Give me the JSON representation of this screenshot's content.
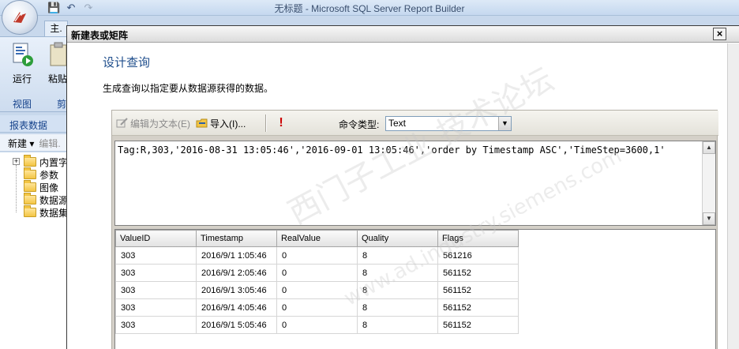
{
  "app": {
    "title": "无标题 - Microsoft SQL Server Report Builder",
    "ribbon_tab": "主.",
    "run_label": "运行",
    "paste_label": "粘贴",
    "group_view": "视图",
    "group_clipboard": "剪"
  },
  "report_data": {
    "header": "报表数据",
    "new_label": "新建 ▾",
    "edit_label": "编辑.",
    "tree": [
      {
        "label": "内置字"
      },
      {
        "label": "参数"
      },
      {
        "label": "图像"
      },
      {
        "label": "数据源"
      },
      {
        "label": "数据集"
      }
    ]
  },
  "dialog": {
    "title": "新建表或矩阵",
    "close": "×",
    "heading": "设计查询",
    "description": "生成查询以指定要从数据源获得的数据。",
    "toolbar": {
      "edit_as_text": "编辑为文本(E)",
      "import": "导入(I)...",
      "run": "!",
      "command_type_label": "命令类型:",
      "command_type_value": "Text"
    },
    "query_text": "Tag:R,303,'2016-08-31 13:05:46','2016-09-01 13:05:46','order by Timestamp ASC','TimeStep=3600,1'",
    "results": {
      "columns": [
        "ValueID",
        "Timestamp",
        "RealValue",
        "Quality",
        "Flags"
      ],
      "rows": [
        [
          "303",
          "2016/9/1 1:05:46",
          "0",
          "8",
          "561216"
        ],
        [
          "303",
          "2016/9/1 2:05:46",
          "0",
          "8",
          "561152"
        ],
        [
          "303",
          "2016/9/1 3:05:46",
          "0",
          "8",
          "561152"
        ],
        [
          "303",
          "2016/9/1 4:05:46",
          "0",
          "8",
          "561152"
        ],
        [
          "303",
          "2016/9/1 5:05:46",
          "0",
          "8",
          "561152"
        ]
      ]
    }
  },
  "watermark": {
    "line1": "西门子工业 技术论坛",
    "line2": "www.ad.industry.siemens.com"
  },
  "icons": [
    "office-orb-icon",
    "save-icon",
    "undo-icon",
    "redo-icon",
    "run-report-icon",
    "paste-icon",
    "folder-icon",
    "edit-text-icon",
    "import-icon",
    "run-query-icon",
    "dropdown-arrow-icon"
  ]
}
